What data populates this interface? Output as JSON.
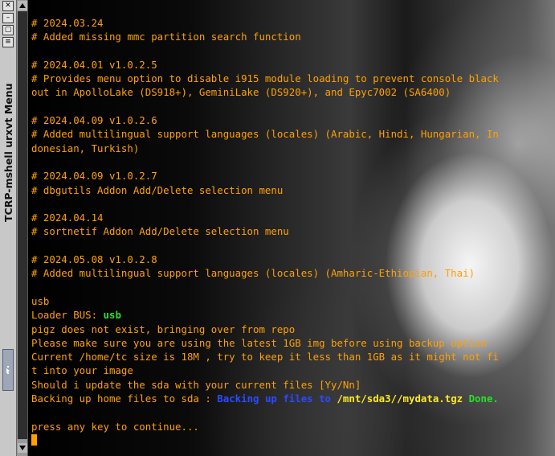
{
  "window": {
    "title": "TCRP-mshell urxvt Menu",
    "buttons": [
      "close",
      "minimize",
      "maximize",
      "menu"
    ]
  },
  "terminal": {
    "lines": [
      [
        {
          "t": "# 2024.03.24",
          "c": "o"
        }
      ],
      [
        {
          "t": "# Added missing mmc partition search function",
          "c": "o"
        }
      ],
      [
        {
          "t": "",
          "c": "o"
        }
      ],
      [
        {
          "t": "# 2024.04.01 v1.0.2.5",
          "c": "o"
        }
      ],
      [
        {
          "t": "# Provides menu option to disable i915 module loading to prevent console black",
          "c": "o"
        }
      ],
      [
        {
          "t": "out in ApolloLake (DS918+), GeminiLake (DS920+), and Epyc7002 (SA6400)",
          "c": "o"
        }
      ],
      [
        {
          "t": "",
          "c": "o"
        }
      ],
      [
        {
          "t": "# 2024.04.09 v1.0.2.6",
          "c": "o"
        }
      ],
      [
        {
          "t": "# Added multilingual support languages (locales) (Arabic, Hindi, Hungarian, In",
          "c": "o"
        }
      ],
      [
        {
          "t": "donesian, Turkish)",
          "c": "o"
        }
      ],
      [
        {
          "t": "",
          "c": "o"
        }
      ],
      [
        {
          "t": "# 2024.04.09 v1.0.2.7",
          "c": "o"
        }
      ],
      [
        {
          "t": "# dbgutils Addon Add/Delete selection menu",
          "c": "o"
        }
      ],
      [
        {
          "t": "",
          "c": "o"
        }
      ],
      [
        {
          "t": "# 2024.04.14",
          "c": "o"
        }
      ],
      [
        {
          "t": "# sortnetif Addon Add/Delete selection menu",
          "c": "o"
        }
      ],
      [
        {
          "t": "",
          "c": "o"
        }
      ],
      [
        {
          "t": "# 2024.05.08 v1.0.2.8",
          "c": "o"
        }
      ],
      [
        {
          "t": "# Added multilingual support languages (locales) (Amharic-Ethiopian, Thai)",
          "c": "o"
        }
      ],
      [
        {
          "t": "",
          "c": "o"
        }
      ],
      [
        {
          "t": "usb",
          "c": "o"
        }
      ],
      [
        {
          "t": "Loader BUS: ",
          "c": "o"
        },
        {
          "t": "usb",
          "c": "g"
        }
      ],
      [
        {
          "t": "pigz does not exist, bringing over from repo",
          "c": "o"
        }
      ],
      [
        {
          "t": "Please make sure you are using the latest 1GB img before using backup option",
          "c": "o"
        }
      ],
      [
        {
          "t": "Current /home/tc size is 18M , try to keep it less than 1GB as it might not fi",
          "c": "o"
        }
      ],
      [
        {
          "t": "t into your image",
          "c": "o"
        }
      ],
      [
        {
          "t": "Should i update the sda with your current files [Yy/Nn]",
          "c": "o"
        }
      ],
      [
        {
          "t": "Backing up home files to sda : ",
          "c": "o"
        },
        {
          "t": "Backing up files to ",
          "c": "b"
        },
        {
          "t": "/mnt/sda3//mydata.tgz ",
          "c": "y"
        },
        {
          "t": "Done.",
          "c": "g"
        }
      ],
      [
        {
          "t": "",
          "c": "o"
        }
      ],
      [
        {
          "t": "press any key to continue...",
          "c": "o"
        }
      ]
    ]
  }
}
